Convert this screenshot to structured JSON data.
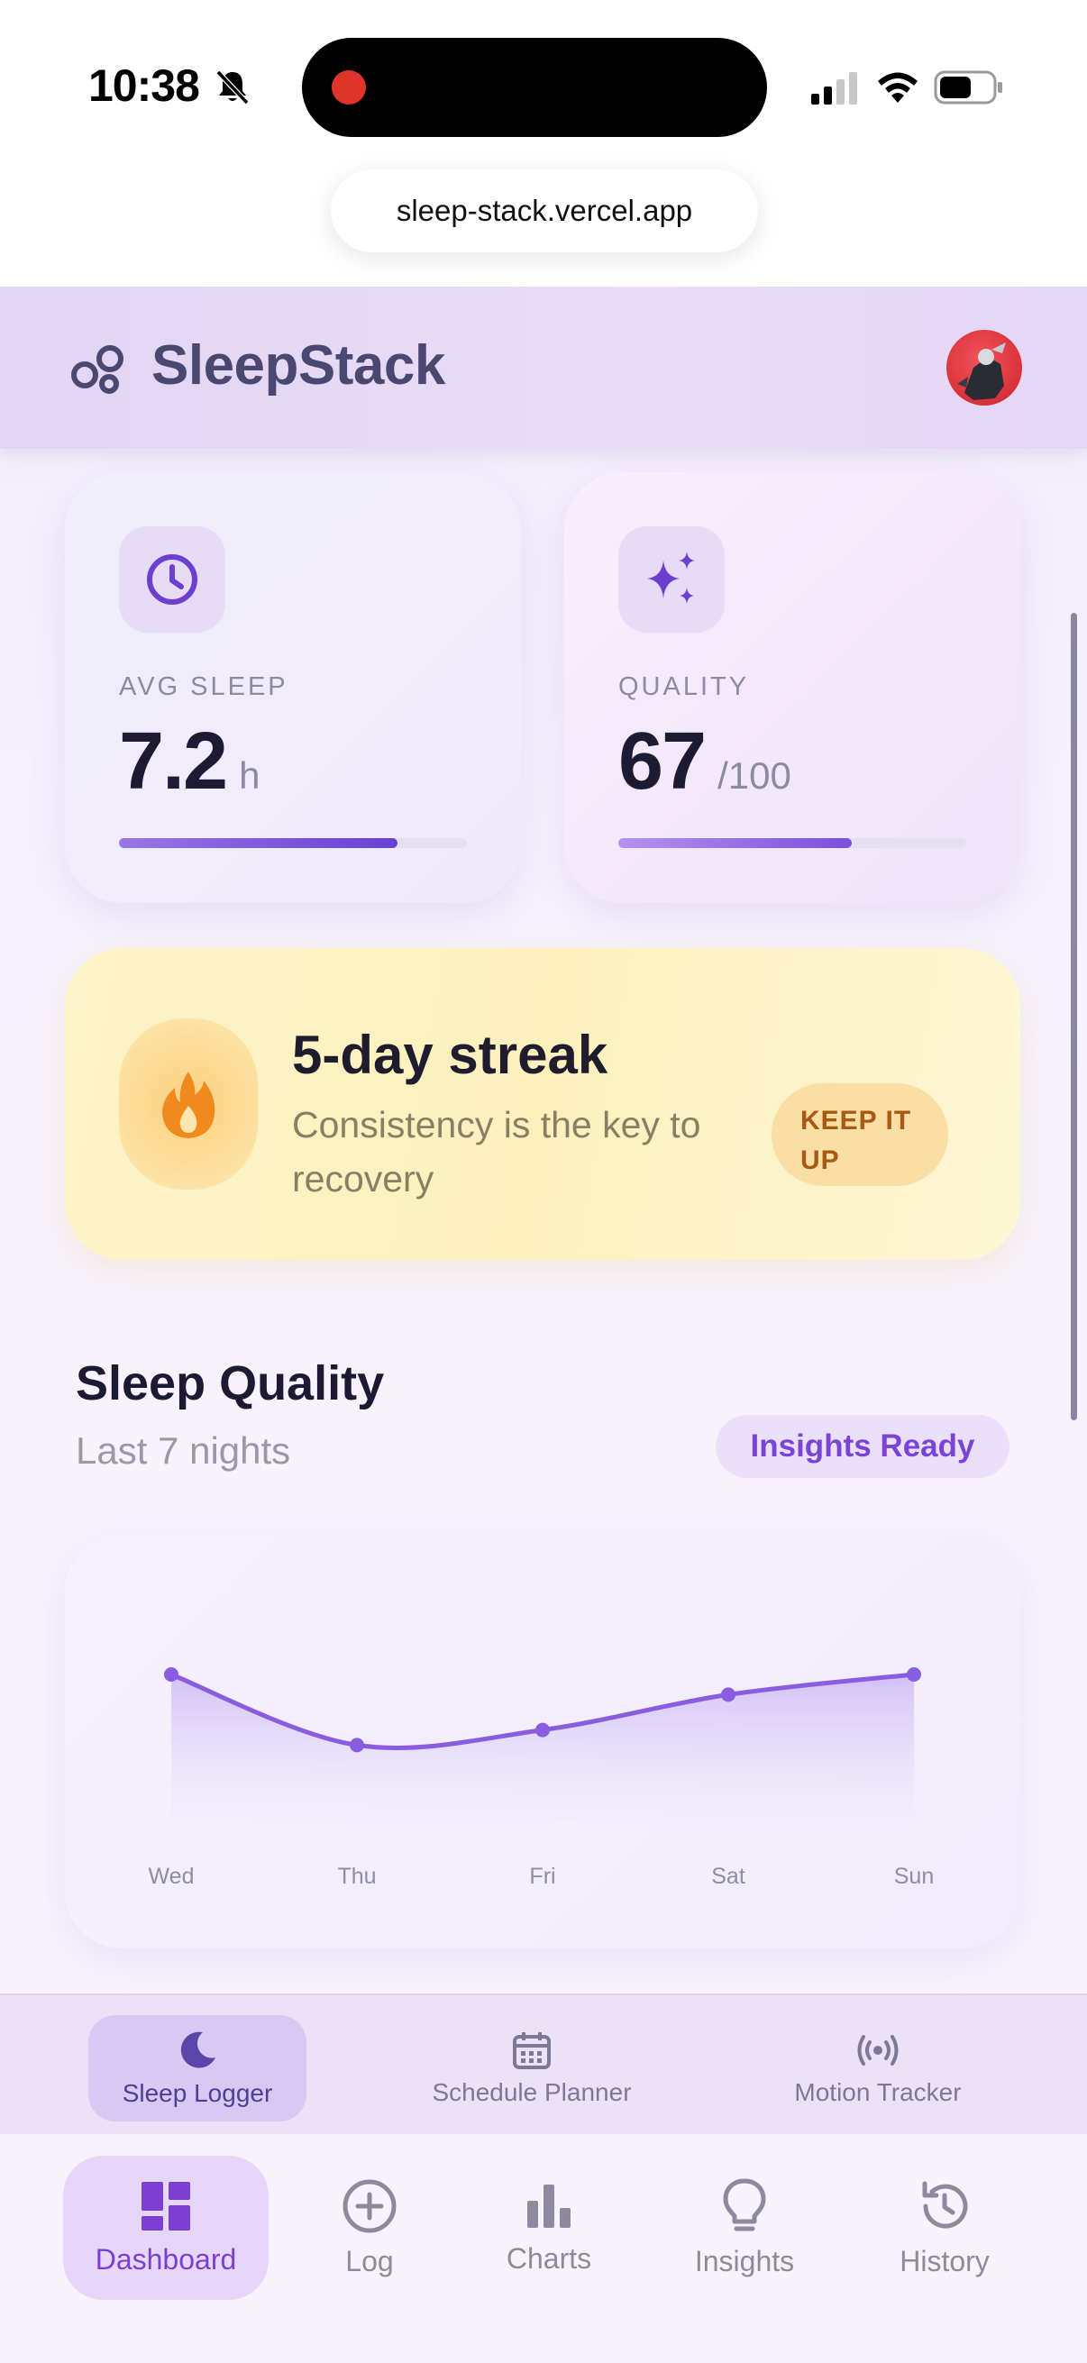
{
  "status_bar": {
    "time": "10:38"
  },
  "browser": {
    "url": "sleep-stack.vercel.app"
  },
  "header": {
    "brand": "SleepStack"
  },
  "stats": {
    "avg_sleep": {
      "label": "AVG SLEEP",
      "value": "7.2",
      "unit": "h",
      "progress": 0.8
    },
    "quality": {
      "label": "QUALITY",
      "value": "67",
      "unit": "/100",
      "progress": 0.67
    }
  },
  "streak": {
    "title": "5-day streak",
    "subtitle": "Consistency is the key to recovery",
    "button_line1": "KEEP IT",
    "button_line2": "UP"
  },
  "sleep_quality": {
    "title": "Sleep Quality",
    "subtitle": "Last 7 nights",
    "badge": "Insights Ready"
  },
  "chart_data": {
    "type": "area",
    "categories": [
      "Wed",
      "Thu",
      "Fri",
      "Sat",
      "Sun"
    ],
    "values": [
      80,
      66,
      69,
      76,
      80
    ],
    "ylim": [
      40,
      90
    ],
    "grid": false,
    "color": "#8a5cdf"
  },
  "subnav": {
    "items": [
      {
        "label": "Sleep Logger",
        "icon": "moon-icon",
        "active": true
      },
      {
        "label": "Schedule Planner",
        "icon": "calendar-icon",
        "active": false
      },
      {
        "label": "Motion Tracker",
        "icon": "broadcast-icon",
        "active": false
      }
    ]
  },
  "tabs": {
    "items": [
      {
        "label": "Dashboard",
        "icon": "dashboard-icon",
        "active": true
      },
      {
        "label": "Log",
        "icon": "plus-circle-icon",
        "active": false
      },
      {
        "label": "Charts",
        "icon": "bar-chart-icon",
        "active": false
      },
      {
        "label": "Insights",
        "icon": "lightbulb-icon",
        "active": false
      },
      {
        "label": "History",
        "icon": "history-icon",
        "active": false
      }
    ]
  },
  "colors": {
    "accent": "#7b3fd2",
    "streak_bg": "#fdf0bd",
    "flame": "#f08a1d"
  }
}
